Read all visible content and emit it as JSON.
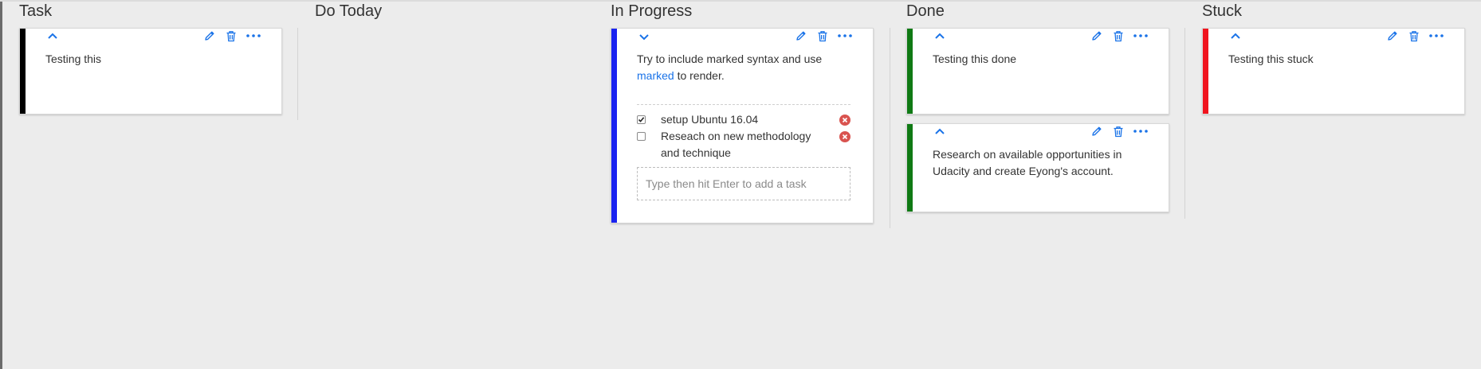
{
  "colors": {
    "accent": "#1a73e8",
    "task": "#000000",
    "in_progress": "#1a23f0",
    "done": "#0f7a14",
    "stuck": "#f0141e",
    "remove": "#d9534f"
  },
  "columns": [
    {
      "title": "Task",
      "cards": [
        {
          "text": "Testing this",
          "collapse_icon": "chevron-up-icon"
        }
      ]
    },
    {
      "title": "Do Today",
      "cards": []
    },
    {
      "title": "In Progress",
      "cards": [
        {
          "text_before_link": "Try to include marked syntax and use",
          "link_text": "marked",
          "text_after_link": "to render.",
          "collapse_icon": "chevron-down-icon",
          "checklist": [
            {
              "label": "setup Ubuntu 16.04",
              "checked": true
            },
            {
              "label": "Reseach on new methodology and technique",
              "checked": false
            }
          ],
          "task_input_placeholder": "Type then hit Enter to add a task"
        }
      ]
    },
    {
      "title": "Done",
      "cards": [
        {
          "text": "Testing this done",
          "collapse_icon": "chevron-up-icon"
        },
        {
          "text": "Research on available opportunities in Udacity and create Eyong's account.",
          "collapse_icon": "chevron-up-icon"
        }
      ]
    },
    {
      "title": "Stuck",
      "cards": [
        {
          "text": "Testing this stuck",
          "collapse_icon": "chevron-up-icon"
        }
      ]
    }
  ]
}
